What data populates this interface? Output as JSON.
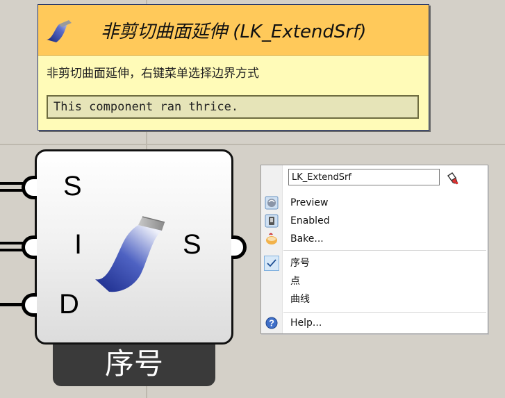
{
  "tooltip": {
    "title": "非剪切曲面延伸 (LK_ExtendSrf)",
    "description": "非剪切曲面延伸，右键菜单选择边界方式",
    "status": "This component ran thrice."
  },
  "component": {
    "inputs": [
      "S",
      "I",
      "D"
    ],
    "outputs": [
      "S"
    ],
    "nickname": "序号",
    "icon": "surface-extend-icon"
  },
  "context_menu": {
    "name_value": "LK_ExtendSrf",
    "items": [
      {
        "label": "Preview",
        "icon": "preview-icon"
      },
      {
        "label": "Enabled",
        "icon": "enabled-icon"
      },
      {
        "label": "Bake...",
        "icon": "bake-icon"
      },
      {
        "label": "序号",
        "icon": "check-icon",
        "checked": true
      },
      {
        "label": "点",
        "checked": false
      },
      {
        "label": "曲线",
        "checked": false
      },
      {
        "label": "Help...",
        "icon": "help-icon"
      }
    ]
  },
  "colors": {
    "canvas": "#d4d0c8",
    "tooltip_header": "#ffc95a",
    "tooltip_body": "#fffbb8",
    "component_tab": "#3a3a3a"
  }
}
